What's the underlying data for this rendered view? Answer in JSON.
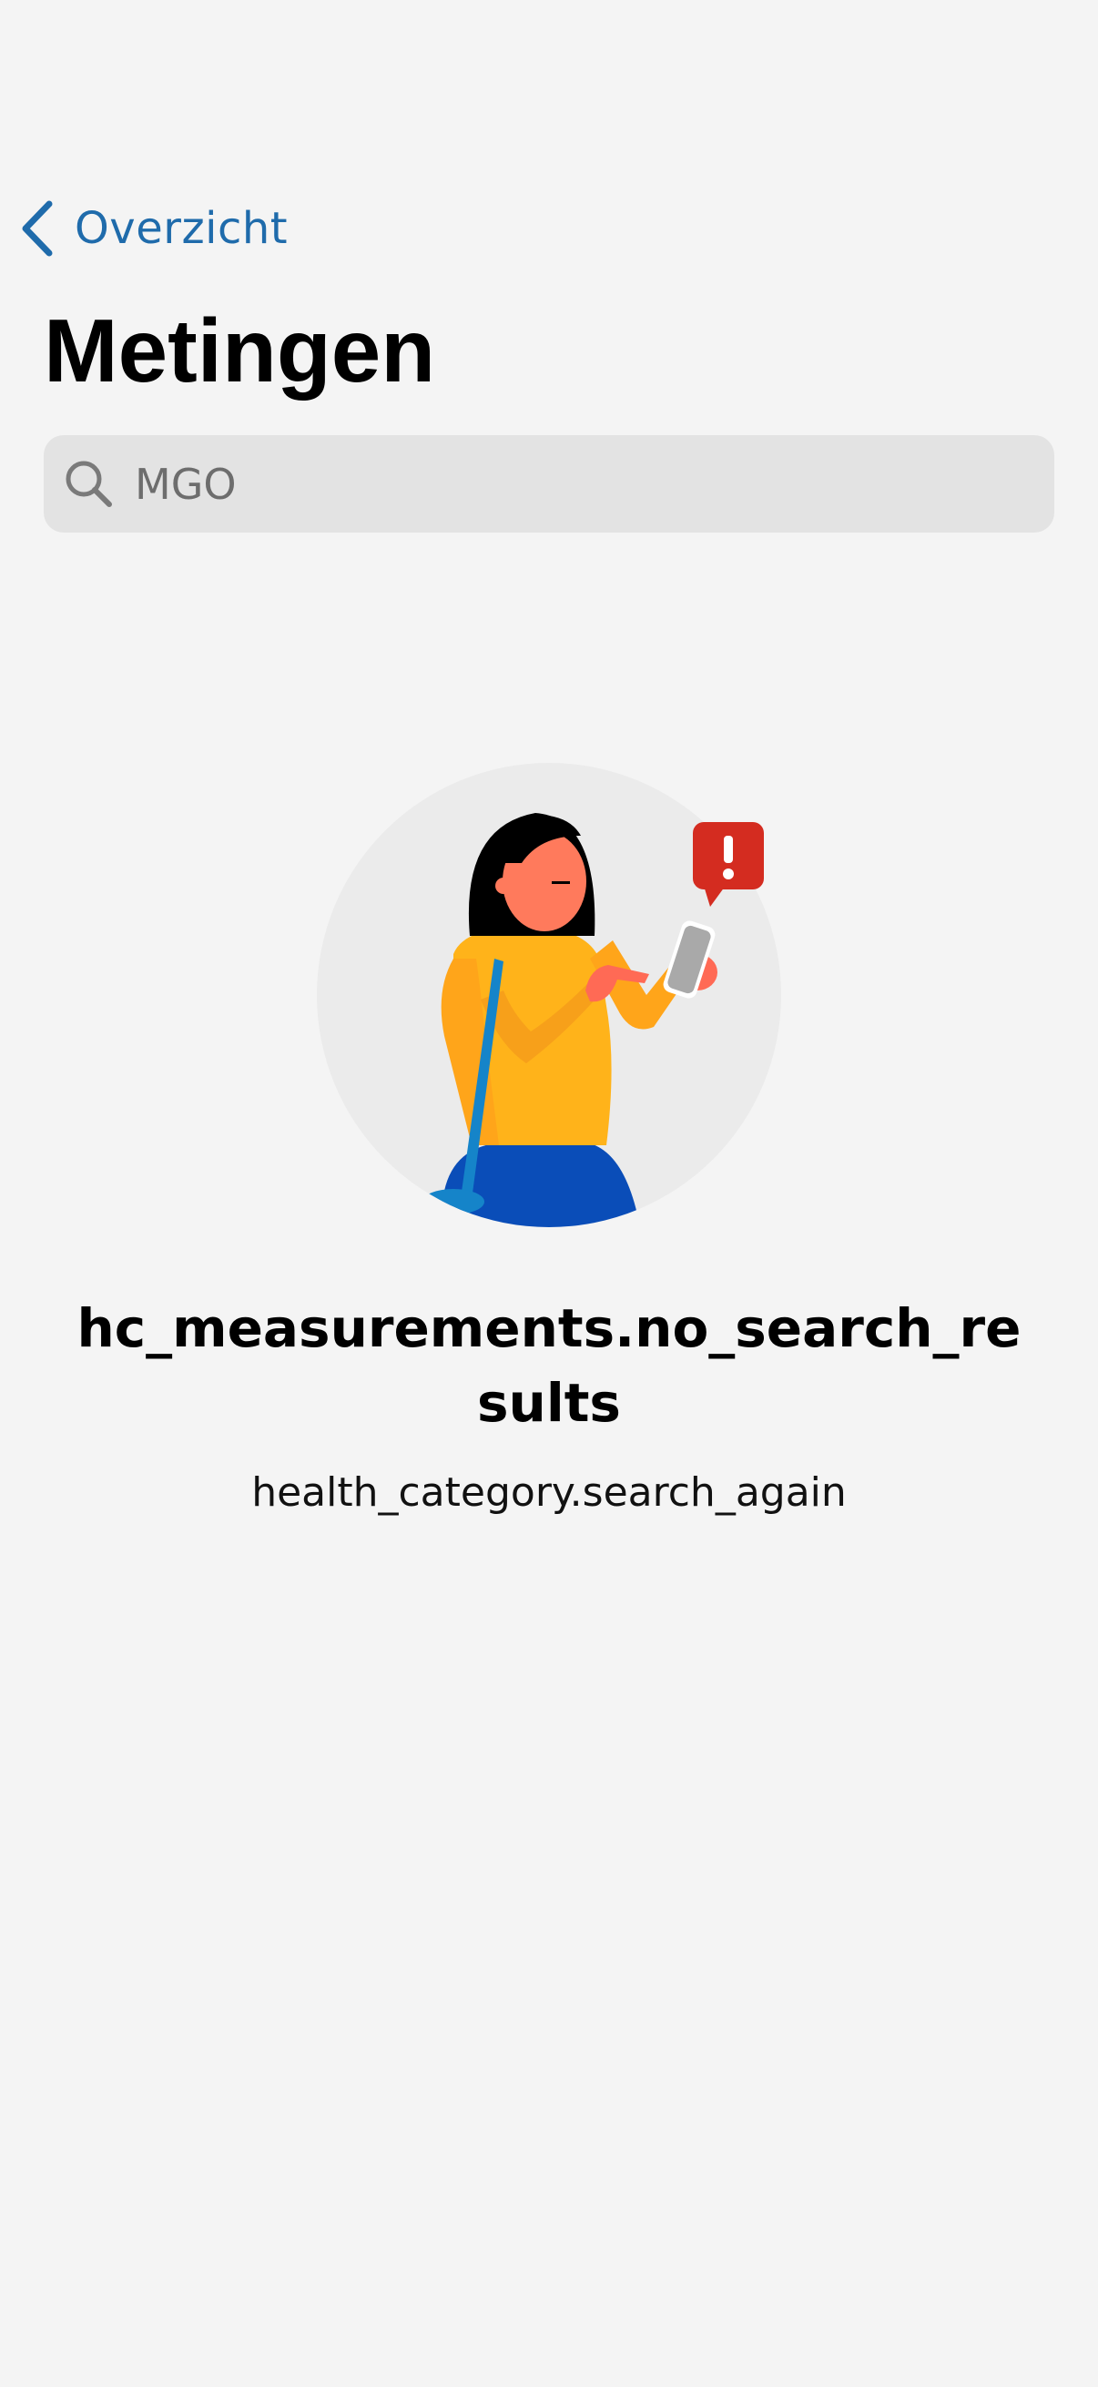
{
  "header": {
    "back_label": "Overzicht",
    "title": "Metingen"
  },
  "search": {
    "value": "MGO",
    "placeholder": "MGO"
  },
  "empty_state": {
    "title": "hc_measurements.no_search_results",
    "subtitle": "health_category.search_again"
  },
  "colors": {
    "accent": "#1f6bab",
    "background": "#f4f4f4",
    "search_field": "#e3e3e3",
    "alert": "#d42c20"
  },
  "icons": {
    "back": "chevron-left-icon",
    "search": "search-icon",
    "alert": "alert-bubble-icon"
  }
}
